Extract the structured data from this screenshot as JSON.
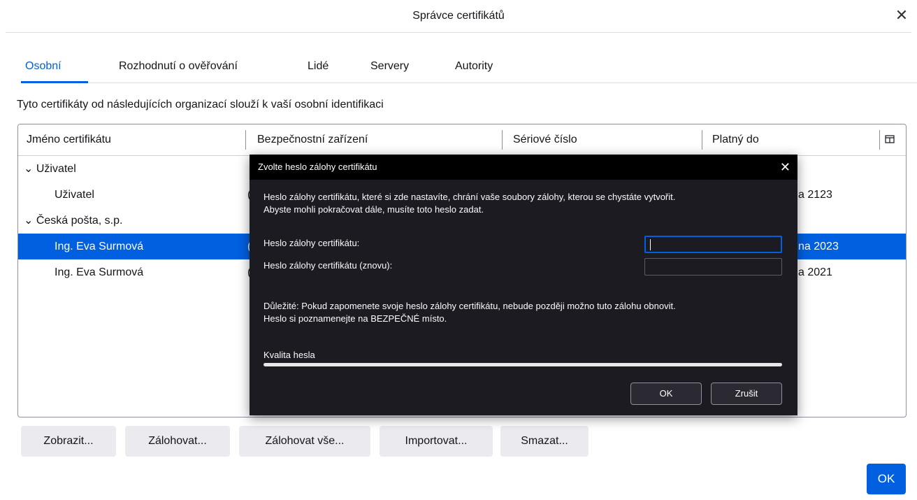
{
  "window": {
    "title": "Správce certifikátů",
    "close_glyph": "✕"
  },
  "tabs": [
    {
      "label": "Osobní",
      "active": true
    },
    {
      "label": "Rozhodnutí o ověřování"
    },
    {
      "label": "Lidé"
    },
    {
      "label": "Servery"
    },
    {
      "label": "Autority"
    }
  ],
  "description": "Tyto certifikáty od následujících organizací slouží k vaší osobní identifikaci",
  "table": {
    "columns": [
      "Jméno certifikátu",
      "Bezpečnostní zařízení",
      "Sériové číslo",
      "Platný do"
    ],
    "column_picker_icon": "column-picker-icon",
    "rows": [
      {
        "name": "⌄ Uživatel",
        "expiry": ""
      },
      {
        "name": "Uživatel",
        "device_fragment": "(",
        "expiry": "a 2123"
      },
      {
        "name": "⌄ Česká pošta, s.p.",
        "expiry": ""
      },
      {
        "name": "Ing. Eva Surmová",
        "device_fragment": "(",
        "expiry": "na 2023",
        "selected": true
      },
      {
        "name": "Ing. Eva Surmová",
        "device_fragment": "(",
        "expiry": "a 2021"
      }
    ]
  },
  "buttons": {
    "view": "Zobrazit...",
    "backup": "Zálohovat...",
    "backup_all": "Zálohovat vše...",
    "import": "Importovat...",
    "delete": "Smazat...",
    "ok": "OK"
  },
  "dialog": {
    "title": "Zvolte heslo zálohy certifikátu",
    "close_glyph": "✕",
    "intro_line1": "Heslo zálohy certifikátu, které si zde nastavíte, chrání vaše soubory zálohy, kterou se chystáte vytvořit.",
    "intro_line2": "Abyste mohli pokračovat dále, musíte toto heslo zadat.",
    "password_label": "Heslo zálohy certifikátu:",
    "password_value": "",
    "confirm_label": "Heslo zálohy certifikátu (znovu):",
    "confirm_value": "",
    "warning_line1": "Důležité: Pokud zapomenete svoje heslo zálohy certifikátu, nebude později možno tuto zálohu obnovit.",
    "warning_line2": "Heslo si poznamenejte na BEZPEČNÉ místo.",
    "quality_label": "Kvalita hesla",
    "quality_value": 0,
    "ok_label": "OK",
    "cancel_label": "Zrušit"
  }
}
